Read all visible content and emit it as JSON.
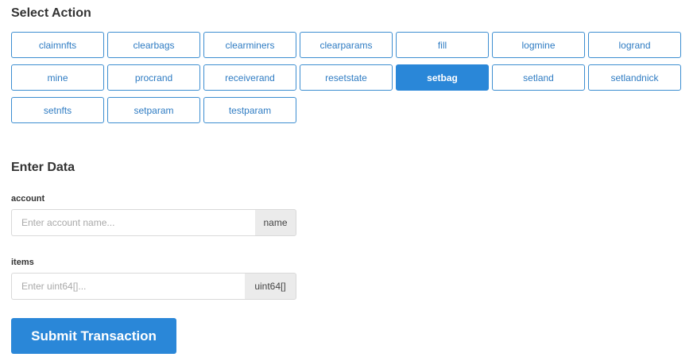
{
  "select_action": {
    "title": "Select Action",
    "actions": [
      {
        "label": "claimnfts",
        "selected": false
      },
      {
        "label": "clearbags",
        "selected": false
      },
      {
        "label": "clearminers",
        "selected": false
      },
      {
        "label": "clearparams",
        "selected": false
      },
      {
        "label": "fill",
        "selected": false
      },
      {
        "label": "logmine",
        "selected": false
      },
      {
        "label": "logrand",
        "selected": false
      },
      {
        "label": "mine",
        "selected": false
      },
      {
        "label": "procrand",
        "selected": false
      },
      {
        "label": "receiverand",
        "selected": false
      },
      {
        "label": "resetstate",
        "selected": false
      },
      {
        "label": "setbag",
        "selected": true
      },
      {
        "label": "setland",
        "selected": false
      },
      {
        "label": "setlandnick",
        "selected": false
      },
      {
        "label": "setnfts",
        "selected": false
      },
      {
        "label": "setparam",
        "selected": false
      },
      {
        "label": "testparam",
        "selected": false
      }
    ]
  },
  "enter_data": {
    "title": "Enter Data",
    "fields": [
      {
        "label": "account",
        "value": "",
        "placeholder": "Enter account name...",
        "type_label": "name"
      },
      {
        "label": "items",
        "value": "",
        "placeholder": "Enter uint64[]...",
        "type_label": "uint64[]"
      }
    ]
  },
  "submit": {
    "label": "Submit Transaction"
  },
  "colors": {
    "accent": "#2a87d8",
    "button_border": "#3d8ed1",
    "addon_bg": "#ebebeb"
  }
}
